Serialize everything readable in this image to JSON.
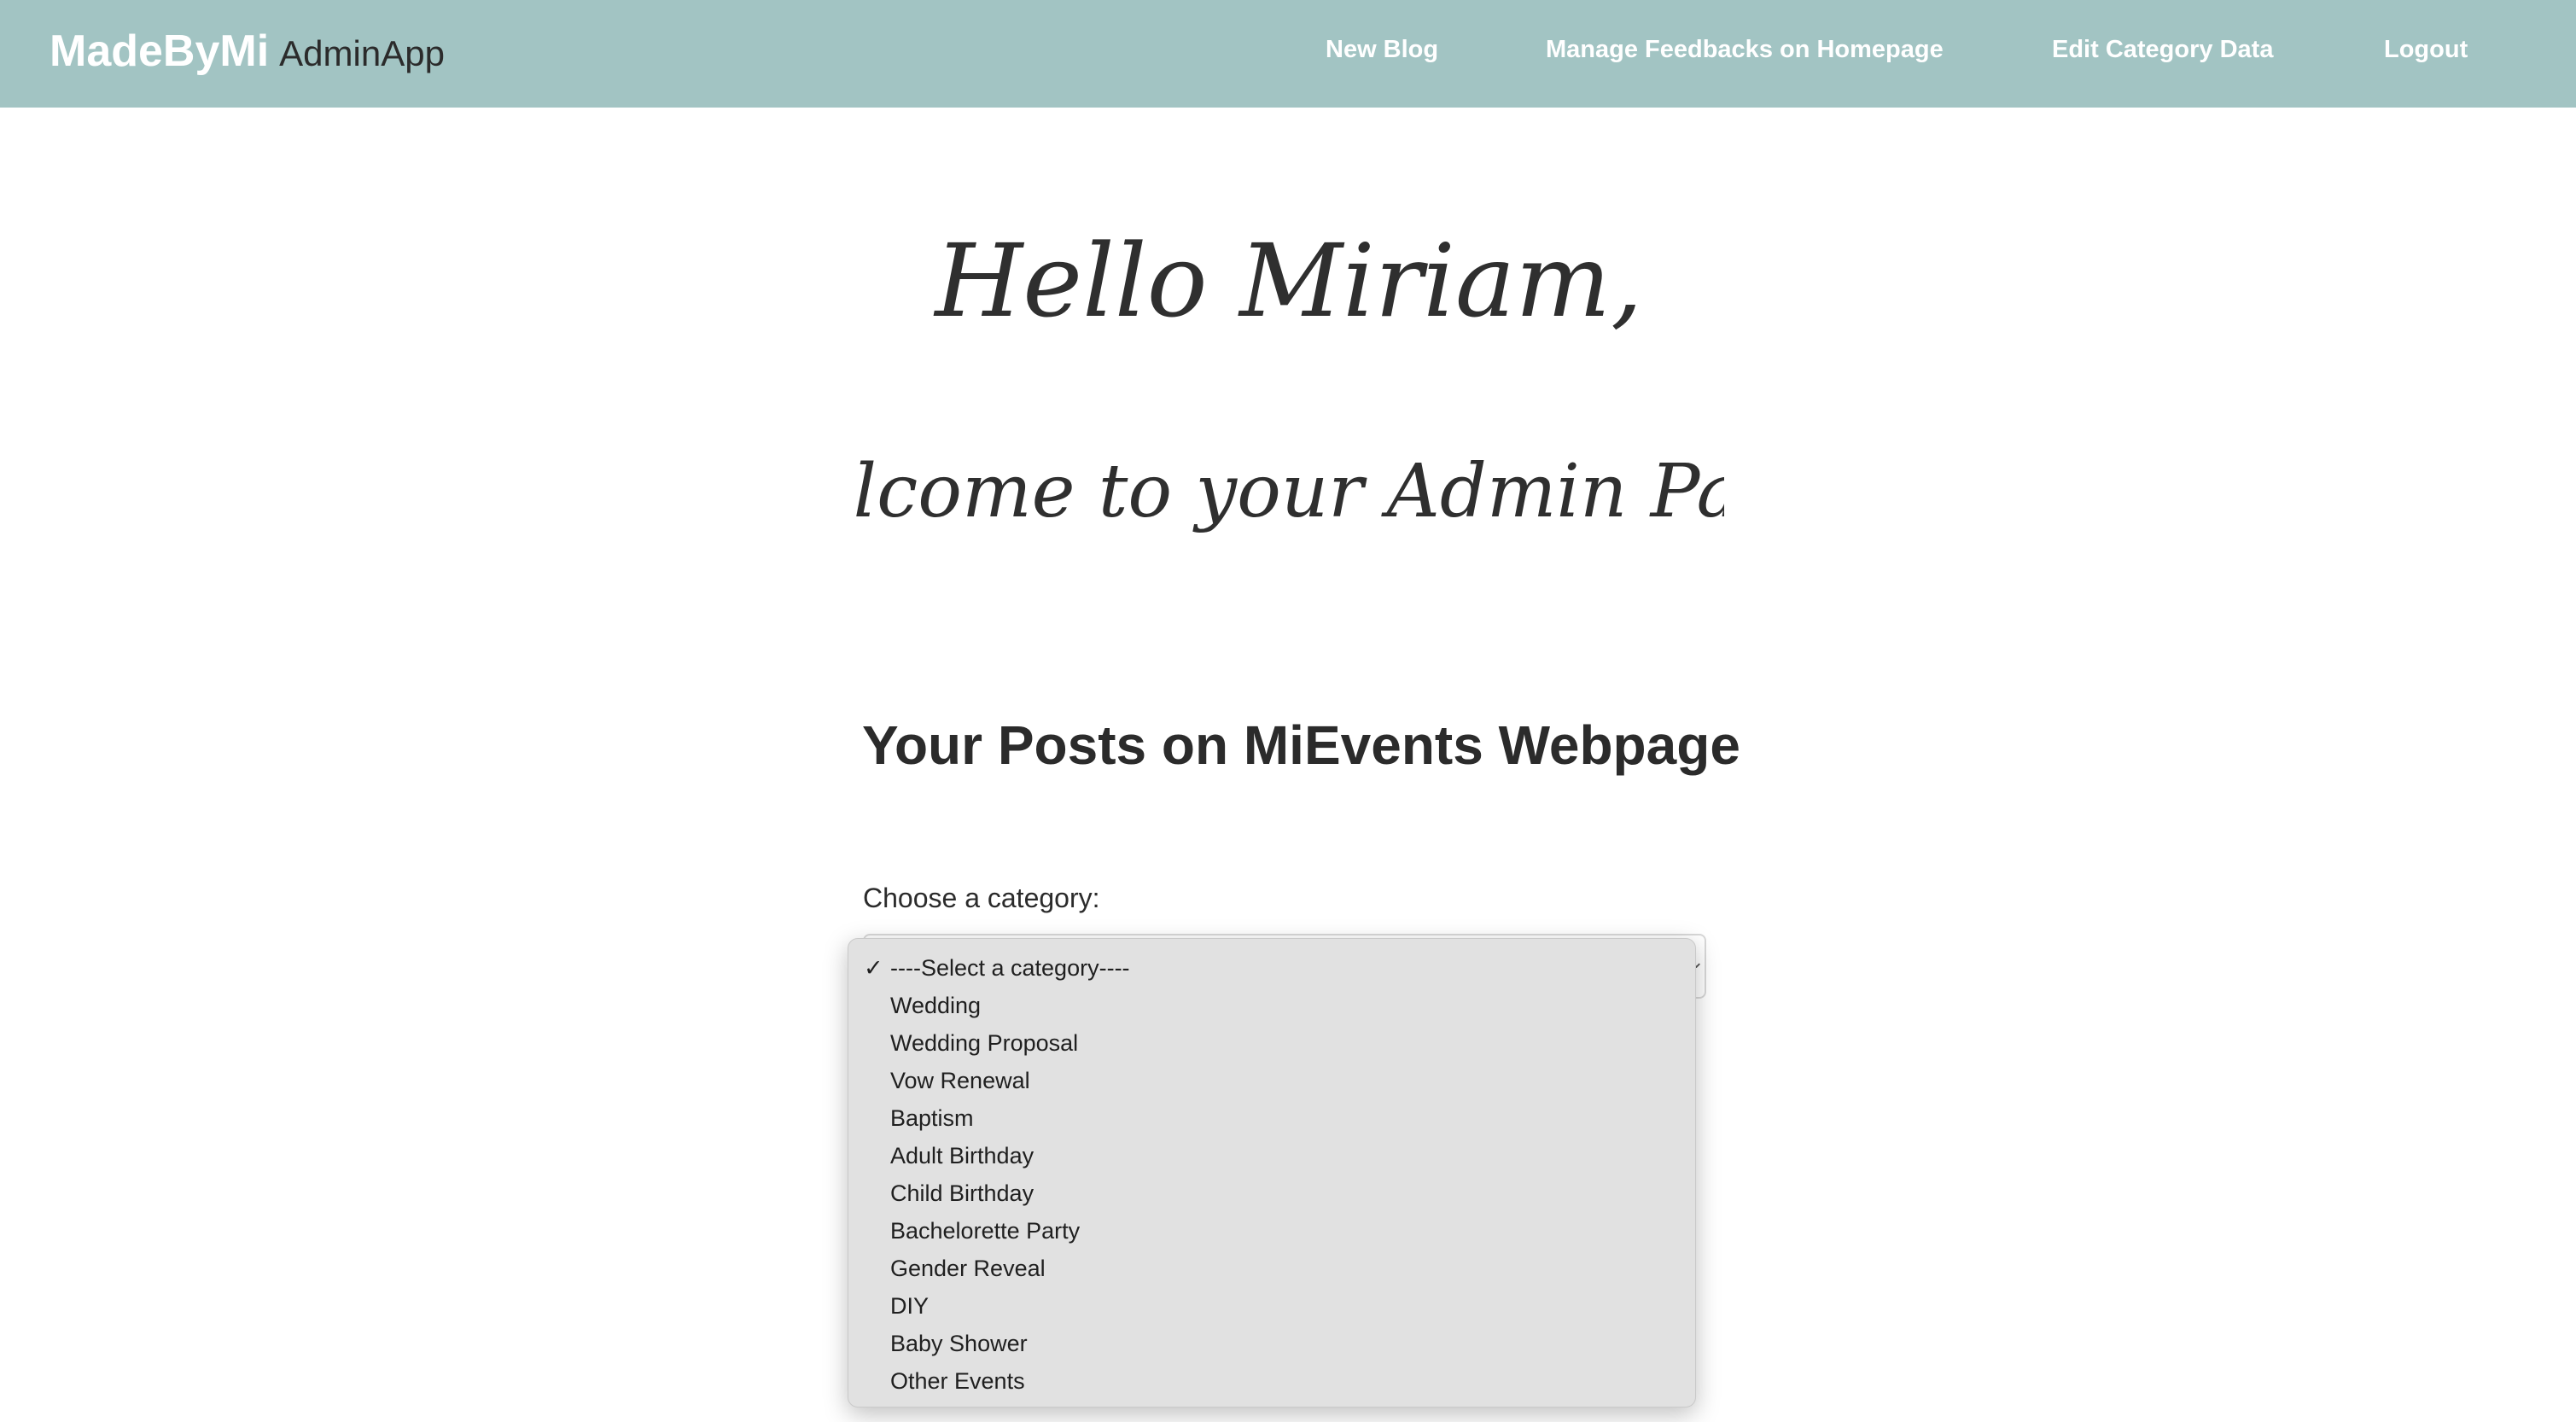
{
  "brand": {
    "name": "MadeByMi",
    "subtitle": "AdminApp"
  },
  "nav": {
    "new_blog": "New Blog",
    "manage_feedbacks": "Manage Feedbacks on Homepage",
    "edit_category": "Edit Category Data",
    "logout": "Logout"
  },
  "greeting": {
    "line1": "Hello Miriam,",
    "line2": "welcome to your Admin Page"
  },
  "main": {
    "title": "Your Posts on MiEvents Webpage",
    "category_label": "Choose a category:"
  },
  "category_select": {
    "selected": "----Select a category----",
    "options": [
      "----Select a category----",
      "Wedding",
      "Wedding Proposal",
      "Vow Renewal",
      "Baptism",
      "Adult Birthday",
      "Child Birthday",
      "Bachelorette Party",
      "Gender Reveal",
      "DIY",
      "Baby Shower",
      "Other Events"
    ]
  },
  "icons": {
    "checkmark": "check-icon",
    "chevron": "chevron-down-icon"
  },
  "colors": {
    "navbar": "#a2c4c3",
    "dropdown_bg": "#e1e1e1",
    "text": "#2b2b2b"
  }
}
